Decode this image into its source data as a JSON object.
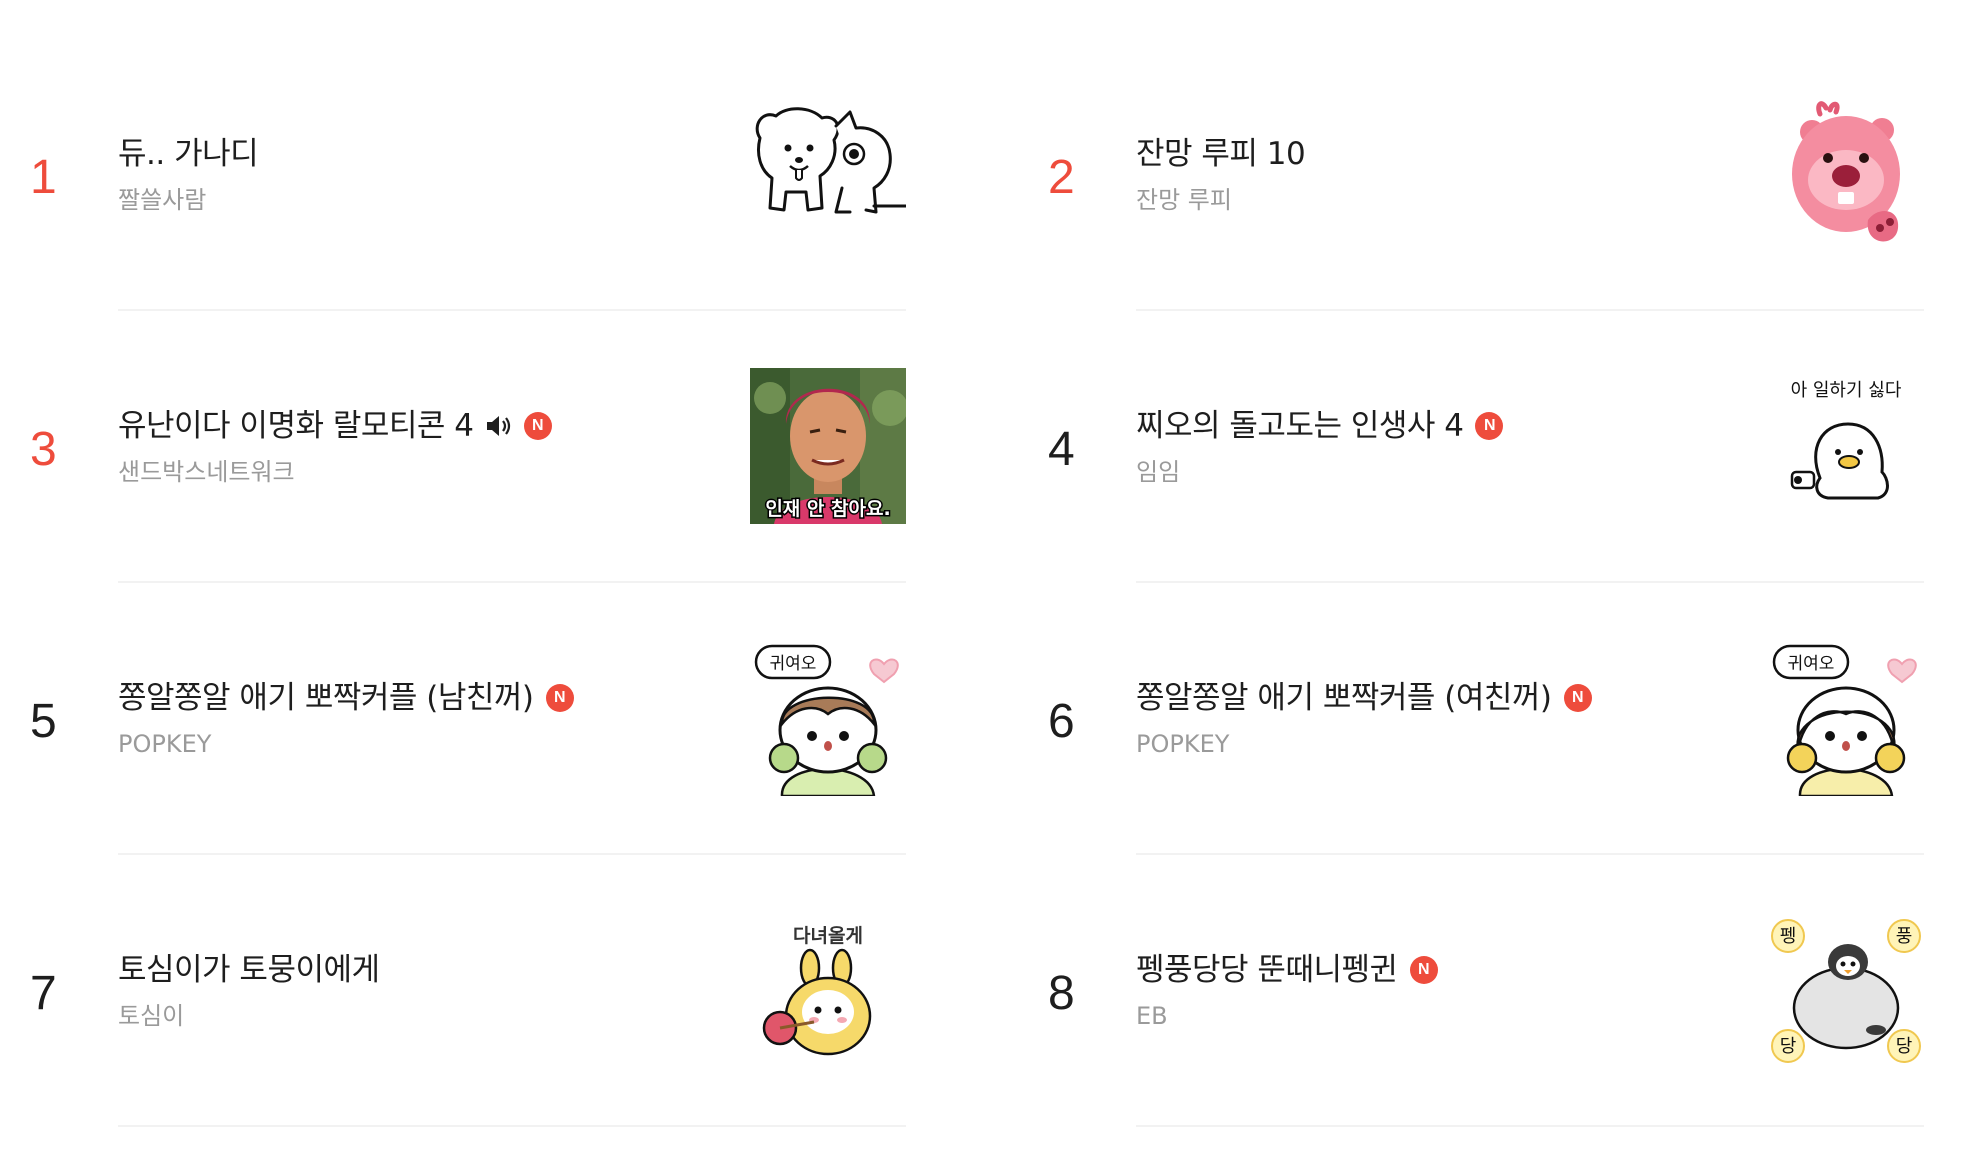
{
  "items": [
    {
      "rank": "1",
      "title": "듀.. 가나디",
      "author": "짤쓸사람",
      "is_new": false,
      "has_sound": false,
      "thumbnail": "white-puppy-and-cat-sketch",
      "rank_color": "#ee4c3c"
    },
    {
      "rank": "2",
      "title": "잔망 루피 10",
      "author": "잔망 루피",
      "is_new": false,
      "has_sound": false,
      "thumbnail": "pink-beaver-character",
      "rank_color": "#ee4c3c"
    },
    {
      "rank": "3",
      "title": "유난이다 이명화 랄모티콘 4",
      "author": "샌드박스네트워크",
      "is_new": true,
      "has_sound": true,
      "thumbnail": "woman-photo-with-caption",
      "thumbnail_caption": "인재 안 참아요.",
      "rank_color": "#ee4c3c"
    },
    {
      "rank": "4",
      "title": "찌오의 돌고도는 인생사 4",
      "author": "임임",
      "is_new": true,
      "has_sound": false,
      "thumbnail": "duck-character-with-toilet-paper",
      "thumbnail_caption": "아 일하기 싫다",
      "rank_color": "#1e1e1e"
    },
    {
      "rank": "5",
      "title": "쫑알쫑알 애기 뽀짝커플 (남친꺼)",
      "author": "POPKEY",
      "is_new": true,
      "has_sound": false,
      "thumbnail": "boy-character-cute-bubble",
      "thumbnail_caption": "귀여오",
      "rank_color": "#1e1e1e"
    },
    {
      "rank": "6",
      "title": "쫑알쫑알 애기 뽀짝커플 (여친꺼)",
      "author": "POPKEY",
      "is_new": true,
      "has_sound": false,
      "thumbnail": "girl-character-cute-bubble",
      "thumbnail_caption": "귀여오",
      "rank_color": "#1e1e1e"
    },
    {
      "rank": "7",
      "title": "토심이가 토뭉이에게",
      "author": "토심이",
      "is_new": false,
      "has_sound": false,
      "thumbnail": "bunny-with-bundle",
      "thumbnail_caption": "다녀올게",
      "rank_color": "#1e1e1e"
    },
    {
      "rank": "8",
      "title": "펭풍당당 뚠때니펭귄",
      "author": "EB",
      "is_new": true,
      "has_sound": false,
      "thumbnail": "penguin-character",
      "thumbnail_caption_chars": [
        "펭",
        "풍",
        "당",
        "당"
      ],
      "rank_color": "#1e1e1e"
    }
  ],
  "badge_label": "N",
  "colors": {
    "accent": "#ee4c3c",
    "text": "#1e1e1e",
    "muted": "#9a9a9a",
    "divider": "#f2f2f2"
  }
}
